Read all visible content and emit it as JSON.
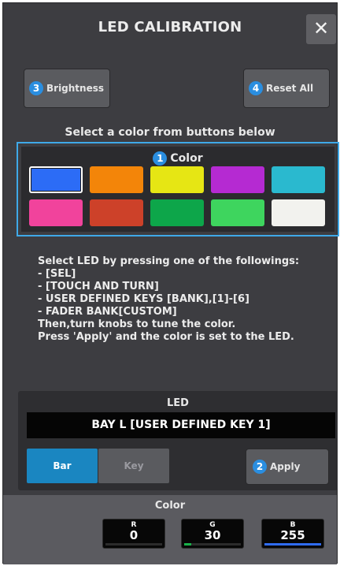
{
  "dialog": {
    "title": "LED CALIBRATION",
    "close_glyph": "✕"
  },
  "buttons": {
    "brightness": {
      "badge": "3",
      "label": "Brightness"
    },
    "reset_all": {
      "badge": "4",
      "label": "Reset All"
    },
    "apply": {
      "badge": "2",
      "label": "Apply"
    }
  },
  "color_selector": {
    "hint": "Select a color from buttons below",
    "badge": "1",
    "label": "Color",
    "selected_index": 0,
    "swatches": [
      "#2c6cf6",
      "#f38509",
      "#e6e614",
      "#b52ad2",
      "#2ab9cf",
      "#f1439c",
      "#cd4129",
      "#0da64a",
      "#3ed55e",
      "#f2f2ee"
    ]
  },
  "instructions": {
    "line1": "Select LED by pressing one of the followings:",
    "items": [
      "- [SEL]",
      "- [TOUCH AND TURN]",
      "- USER DEFINED KEYS [BANK],[1]-[6]",
      "- FADER BANK[CUSTOM]"
    ],
    "line2": "Then,turn knobs to tune the color.",
    "line3": "Press 'Apply' and the color is set to the LED."
  },
  "led": {
    "title": "LED",
    "display": "BAY L [USER DEFINED KEY 1]",
    "toggle_bar": "Bar",
    "toggle_key": "Key",
    "active_toggle": "Bar"
  },
  "color_knobs": {
    "title": "Color",
    "knobs": [
      {
        "label": "R",
        "value": "0",
        "fill": 0.0,
        "color": "#d13030"
      },
      {
        "label": "G",
        "value": "30",
        "fill": 0.12,
        "color": "#19b14a"
      },
      {
        "label": "B",
        "value": "255",
        "fill": 1.0,
        "color": "#2f6bf0"
      }
    ]
  }
}
